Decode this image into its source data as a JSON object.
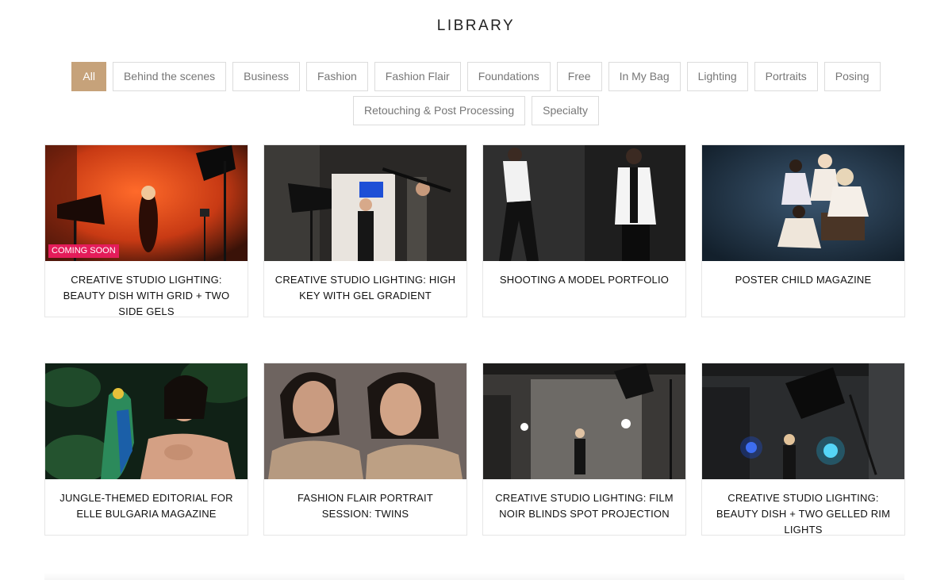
{
  "page": {
    "title": "LIBRARY"
  },
  "filters": [
    {
      "label": "All",
      "active": true
    },
    {
      "label": "Behind the scenes",
      "active": false
    },
    {
      "label": "Business",
      "active": false
    },
    {
      "label": "Fashion",
      "active": false
    },
    {
      "label": "Fashion Flair",
      "active": false
    },
    {
      "label": "Foundations",
      "active": false
    },
    {
      "label": "Free",
      "active": false
    },
    {
      "label": "In My Bag",
      "active": false
    },
    {
      "label": "Lighting",
      "active": false
    },
    {
      "label": "Portraits",
      "active": false
    },
    {
      "label": "Posing",
      "active": false
    },
    {
      "label": "Retouching & Post Processing",
      "active": false
    },
    {
      "label": "Specialty",
      "active": false
    }
  ],
  "courses": [
    {
      "title": "Creative Studio Lighting: Beauty Dish With Grid + Two Side Gels",
      "badge": "Coming Soon"
    },
    {
      "title": "Creative Studio Lighting: High Key With Gel Gradient",
      "badge": ""
    },
    {
      "title": "Shooting A Model Portfolio",
      "badge": ""
    },
    {
      "title": "Poster Child Magazine",
      "badge": ""
    },
    {
      "title": "Jungle-Themed Editorial For Elle Bulgaria Magazine",
      "badge": ""
    },
    {
      "title": "Fashion Flair Portrait Session: Twins",
      "badge": ""
    },
    {
      "title": "Creative Studio Lighting: Film Noir Blinds Spot Projection",
      "badge": ""
    },
    {
      "title": "Creative Studio Lighting: Beauty Dish + Two Gelled Rim Lights",
      "badge": ""
    }
  ],
  "colors": {
    "accent": "#c6a27a",
    "badge": "#e41c5a",
    "border": "#dcdcdc"
  }
}
